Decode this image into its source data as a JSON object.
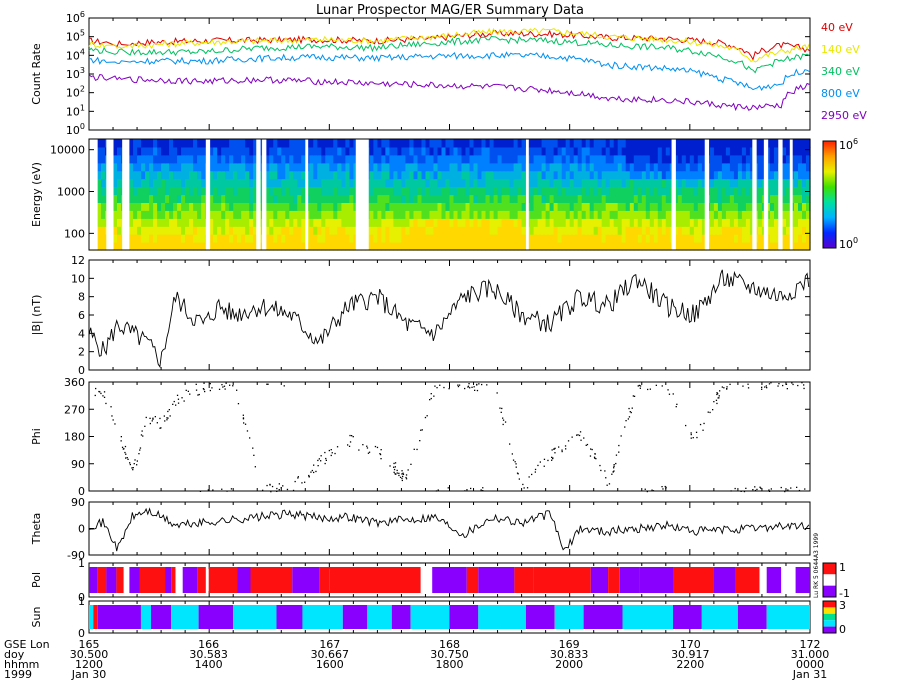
{
  "title": "Lunar Prospector MAG/ER Summary Data",
  "colors": {
    "40 eV": "#e00000",
    "140 eV": "#e8e800",
    "340 eV": "#00c060",
    "800 eV": "#0090f0",
    "2950 eV": "#8000c0",
    "pol_pos": "#ff1010",
    "pol_neg": "#8a00ff",
    "sun_a": "#00e6ff",
    "sun_b": "#8a00ff",
    "sun_c": "#ff1010"
  },
  "chart_data": [
    {
      "type": "line",
      "panel": "count_rate",
      "ylabel": "Count Rate",
      "yscale": "log",
      "ylim": [
        1,
        1000000
      ],
      "y_ticks": [
        "10^0",
        "10^1",
        "10^2",
        "10^3",
        "10^4",
        "10^5",
        "10^6"
      ],
      "legend_position": "right",
      "series": [
        {
          "name": "40 eV",
          "color_key": "40 eV",
          "x": [
            30.5,
            30.52,
            30.54,
            30.58,
            30.62,
            30.66,
            30.7,
            30.74,
            30.78,
            30.82,
            30.86,
            30.9,
            30.94,
            30.96,
            30.98,
            31.0
          ],
          "y": [
            60000,
            40000,
            50000,
            60000,
            65000,
            70000,
            60000,
            80000,
            150000,
            140000,
            90000,
            80000,
            45000,
            8000,
            35000,
            20000
          ]
        },
        {
          "name": "140 eV",
          "color_key": "140 eV",
          "x": [
            30.5,
            30.52,
            30.54,
            30.58,
            30.62,
            30.66,
            30.7,
            30.74,
            30.78,
            30.82,
            30.86,
            30.9,
            30.94,
            30.96,
            30.98,
            31.0
          ],
          "y": [
            40000,
            30000,
            35000,
            50000,
            60000,
            70000,
            60000,
            100000,
            180000,
            200000,
            100000,
            70000,
            30000,
            5000,
            15000,
            30000
          ]
        },
        {
          "name": "340 eV",
          "color_key": "340 eV",
          "x": [
            30.5,
            30.52,
            30.54,
            30.58,
            30.62,
            30.66,
            30.7,
            30.74,
            30.78,
            30.82,
            30.86,
            30.9,
            30.94,
            30.96,
            30.98,
            31.0
          ],
          "y": [
            20000,
            15000,
            15000,
            15000,
            25000,
            30000,
            25000,
            45000,
            70000,
            60000,
            35000,
            25000,
            8000,
            1000,
            5000,
            10000
          ]
        },
        {
          "name": "800 eV",
          "color_key": "800 eV",
          "x": [
            30.5,
            30.52,
            30.54,
            30.58,
            30.62,
            30.66,
            30.7,
            30.74,
            30.78,
            30.82,
            30.86,
            30.9,
            30.94,
            30.96,
            30.98,
            31.0
          ],
          "y": [
            6000,
            4000,
            5000,
            5000,
            7000,
            8000,
            7000,
            9000,
            10000,
            9000,
            3000,
            2000,
            500,
            150,
            300,
            2000
          ]
        },
        {
          "name": "2950 eV",
          "color_key": "2950 eV",
          "x": [
            30.5,
            30.52,
            30.54,
            30.58,
            30.62,
            30.66,
            30.7,
            30.74,
            30.78,
            30.82,
            30.86,
            30.9,
            30.94,
            30.96,
            30.98,
            31.0
          ],
          "y": [
            700,
            500,
            500,
            400,
            500,
            400,
            300,
            250,
            200,
            130,
            50,
            40,
            20,
            15,
            20,
            250
          ]
        }
      ]
    },
    {
      "type": "heatmap",
      "panel": "energy_spectrogram",
      "ylabel": "Energy (eV)",
      "yscale": "log",
      "ylim": [
        40,
        18000
      ],
      "y_ticks": [
        "100",
        "1000",
        "10000"
      ],
      "colorbar_range": [
        "10^0",
        "10^6"
      ],
      "x_range": [
        30.5,
        31.0
      ],
      "data_gaps": [
        [
          30.5,
          30.506
        ],
        [
          30.512,
          30.517
        ],
        [
          30.523,
          30.528
        ],
        [
          30.581,
          30.584
        ],
        [
          30.616,
          30.619
        ],
        [
          30.62,
          30.623
        ],
        [
          30.65,
          30.652
        ],
        [
          30.685,
          30.694
        ],
        [
          30.803,
          30.805
        ],
        [
          30.904,
          30.907
        ],
        [
          30.927,
          30.93
        ],
        [
          30.96,
          30.963
        ],
        [
          30.968,
          30.971
        ],
        [
          30.978,
          30.981
        ],
        [
          30.986,
          30.988
        ]
      ]
    },
    {
      "type": "line",
      "panel": "field_magnitude",
      "ylabel": "|B| (nT)",
      "ylim": [
        0,
        12
      ],
      "y_ticks": [
        "0",
        "2",
        "4",
        "6",
        "8",
        "10",
        "12"
      ],
      "x": [
        30.5,
        30.51,
        30.52,
        30.53,
        30.54,
        30.55,
        30.56,
        30.57,
        30.58,
        30.59,
        30.6,
        30.62,
        30.64,
        30.66,
        30.68,
        30.7,
        30.72,
        30.74,
        30.76,
        30.78,
        30.8,
        30.82,
        30.84,
        30.86,
        30.88,
        30.9,
        30.92,
        30.94,
        30.96,
        30.98,
        31.0
      ],
      "y": [
        4,
        2,
        5,
        4,
        3,
        1,
        8,
        6,
        5,
        7,
        6,
        7,
        6,
        3,
        7,
        8,
        5,
        4,
        8,
        9,
        6,
        5,
        8,
        7,
        10,
        7,
        6,
        10,
        9,
        8,
        10
      ]
    },
    {
      "type": "scatter",
      "panel": "phi",
      "ylabel": "Phi",
      "ylim": [
        0,
        360
      ],
      "y_ticks": [
        "0",
        "90",
        "180",
        "270",
        "360"
      ],
      "x": [
        30.5,
        30.51,
        30.52,
        30.53,
        30.54,
        30.55,
        30.56,
        30.58,
        30.6,
        30.62,
        30.64,
        30.66,
        30.68,
        30.7,
        30.72,
        30.74,
        30.76,
        30.78,
        30.8,
        30.82,
        30.84,
        30.86,
        30.88,
        30.9,
        30.92,
        30.94,
        30.96,
        30.98,
        31.0
      ],
      "y": [
        340,
        320,
        200,
        60,
        250,
        220,
        300,
        350,
        355,
        5,
        10,
        100,
        170,
        130,
        40,
        355,
        350,
        358,
        10,
        120,
        190,
        30,
        350,
        358,
        170,
        355,
        358,
        355,
        360
      ]
    },
    {
      "type": "line",
      "panel": "theta",
      "ylabel": "Theta",
      "ylim": [
        -90,
        90
      ],
      "y_ticks": [
        "-90",
        "0",
        "90"
      ],
      "x": [
        30.5,
        30.51,
        30.52,
        30.53,
        30.54,
        30.55,
        30.56,
        30.58,
        30.6,
        30.62,
        30.64,
        30.66,
        30.68,
        30.7,
        30.72,
        30.74,
        30.76,
        30.78,
        30.8,
        30.82,
        30.83,
        30.84,
        30.86,
        30.88,
        30.9,
        30.92,
        30.94,
        30.96,
        30.98,
        31.0
      ],
      "y": [
        10,
        20,
        -70,
        40,
        60,
        40,
        10,
        20,
        30,
        40,
        50,
        35,
        40,
        20,
        30,
        40,
        -20,
        40,
        20,
        50,
        -80,
        0,
        -10,
        0,
        10,
        -10,
        -5,
        0,
        10,
        5
      ]
    },
    {
      "type": "bar",
      "panel": "polarity",
      "ylabel": "Pol",
      "ylim": [
        0,
        1
      ],
      "y_ticks": [
        "0",
        "1"
      ],
      "colorbar_ticks": [
        "1",
        "-1"
      ],
      "segments": [
        [
          30.5,
          30.506,
          "pol_neg"
        ],
        [
          30.506,
          30.512,
          "pol_pos"
        ],
        [
          30.512,
          30.519,
          "pol_neg"
        ],
        [
          30.519,
          30.524,
          "pol_pos"
        ],
        [
          30.528,
          30.535,
          "pol_neg"
        ],
        [
          30.535,
          30.553,
          "pol_pos"
        ],
        [
          30.553,
          30.557,
          "pol_neg"
        ],
        [
          30.557,
          30.56,
          "pol_pos"
        ],
        [
          30.565,
          30.575,
          "pol_neg"
        ],
        [
          30.575,
          30.581,
          "pol_pos"
        ],
        [
          30.583,
          30.603,
          "pol_pos"
        ],
        [
          30.603,
          30.612,
          "pol_neg"
        ],
        [
          30.612,
          30.641,
          "pol_pos"
        ],
        [
          30.641,
          30.66,
          "pol_neg"
        ],
        [
          30.66,
          30.667,
          "pol_pos"
        ],
        [
          30.667,
          30.73,
          "pol_pos"
        ],
        [
          30.738,
          30.762,
          "pol_neg"
        ],
        [
          30.762,
          30.77,
          "pol_pos"
        ],
        [
          30.77,
          30.795,
          "pol_neg"
        ],
        [
          30.795,
          30.808,
          "pol_pos"
        ],
        [
          30.808,
          30.848,
          "pol_pos"
        ],
        [
          30.848,
          30.86,
          "pol_neg"
        ],
        [
          30.86,
          30.868,
          "pol_pos"
        ],
        [
          30.868,
          30.882,
          "pol_neg"
        ],
        [
          30.882,
          30.905,
          "pol_neg"
        ],
        [
          30.905,
          30.933,
          "pol_pos"
        ],
        [
          30.933,
          30.948,
          "pol_neg"
        ],
        [
          30.948,
          30.965,
          "pol_pos"
        ],
        [
          30.97,
          30.98,
          "pol_neg"
        ],
        [
          30.99,
          31.0,
          "pol_neg"
        ]
      ]
    },
    {
      "type": "bar",
      "panel": "sun",
      "ylabel": "Sun",
      "ylim": [
        0,
        1
      ],
      "y_ticks": [
        "0",
        "1"
      ],
      "colorbar_ticks": [
        "3",
        "0"
      ],
      "segments": [
        [
          30.5,
          30.503,
          "sun_a"
        ],
        [
          30.503,
          30.506,
          "sun_c"
        ],
        [
          30.506,
          30.536,
          "sun_b"
        ],
        [
          30.536,
          30.543,
          "sun_a"
        ],
        [
          30.543,
          30.557,
          "sun_b"
        ],
        [
          30.557,
          30.576,
          "sun_a"
        ],
        [
          30.576,
          30.6,
          "sun_b"
        ],
        [
          30.6,
          30.63,
          "sun_a"
        ],
        [
          30.63,
          30.648,
          "sun_b"
        ],
        [
          30.648,
          30.676,
          "sun_a"
        ],
        [
          30.676,
          30.693,
          "sun_b"
        ],
        [
          30.693,
          30.71,
          "sun_a"
        ],
        [
          30.71,
          30.723,
          "sun_b"
        ],
        [
          30.723,
          30.75,
          "sun_a"
        ],
        [
          30.75,
          30.77,
          "sun_b"
        ],
        [
          30.77,
          30.803,
          "sun_a"
        ],
        [
          30.803,
          30.823,
          "sun_b"
        ],
        [
          30.823,
          30.843,
          "sun_a"
        ],
        [
          30.843,
          30.87,
          "sun_b"
        ],
        [
          30.87,
          30.905,
          "sun_a"
        ],
        [
          30.905,
          30.925,
          "sun_b"
        ],
        [
          30.925,
          30.95,
          "sun_a"
        ],
        [
          30.95,
          30.97,
          "sun_b"
        ],
        [
          30.97,
          31.0,
          "sun_a"
        ]
      ]
    }
  ],
  "x_axis": {
    "row_labels": [
      "GSE Lon",
      "doy",
      "hhmm",
      "1999"
    ],
    "ticks": [
      {
        "x": 30.5,
        "lines": [
          "165",
          "30.500",
          "1200",
          "Jan 30"
        ]
      },
      {
        "x": 30.583,
        "lines": [
          "166",
          "30.583",
          "1400",
          ""
        ]
      },
      {
        "x": 30.667,
        "lines": [
          "167",
          "30.667",
          "1600",
          ""
        ]
      },
      {
        "x": 30.75,
        "lines": [
          "168",
          "30.750",
          "1800",
          ""
        ]
      },
      {
        "x": 30.833,
        "lines": [
          "169",
          "30.833",
          "2000",
          ""
        ]
      },
      {
        "x": 30.917,
        "lines": [
          "170",
          "30.917",
          "2200",
          ""
        ]
      },
      {
        "x": 31.0,
        "lines": [
          "172",
          "31.000",
          "0000",
          "Jan 31"
        ]
      }
    ]
  },
  "side_label": "Lu RK 5 0644A3 1999"
}
